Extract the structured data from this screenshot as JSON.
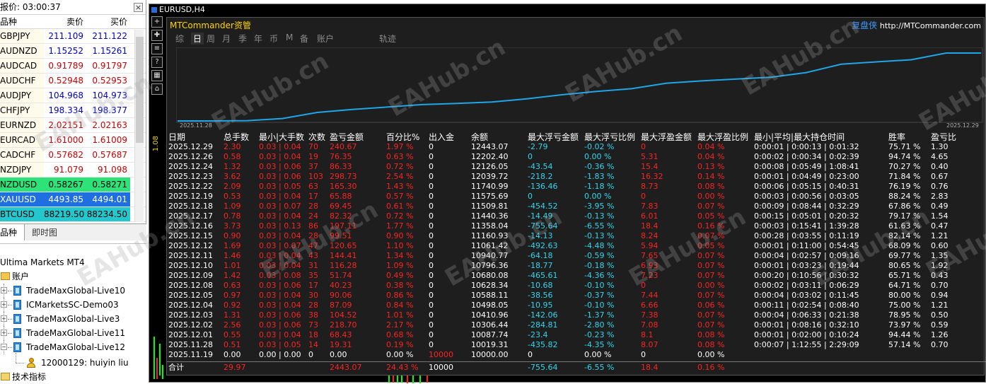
{
  "market_watch": {
    "title": "报价: 03:00:37",
    "close_icon": "close-icon",
    "columns": {
      "symbol": "品种",
      "bid": "卖价",
      "ask": "买价"
    },
    "rows": [
      {
        "symbol": "GBPJPY",
        "bid": "211.109",
        "ask": "211.122",
        "bid_color": "#0000cc",
        "ask_color": "#0000cc",
        "bg": ""
      },
      {
        "symbol": "AUDNZD",
        "bid": "1.15252",
        "ask": "1.15261",
        "bid_color": "#0000cc",
        "ask_color": "#0000cc",
        "bg": ""
      },
      {
        "symbol": "AUDCAD",
        "bid": "0.91789",
        "ask": "0.91797",
        "bid_color": "#cc0000",
        "ask_color": "#cc0000",
        "bg": ""
      },
      {
        "symbol": "AUDCHF",
        "bid": "0.52948",
        "ask": "0.52953",
        "bid_color": "#cc0000",
        "ask_color": "#cc0000",
        "bg": ""
      },
      {
        "symbol": "AUDJPY",
        "bid": "104.968",
        "ask": "104.973",
        "bid_color": "#0000cc",
        "ask_color": "#0000cc",
        "bg": ""
      },
      {
        "symbol": "CHFJPY",
        "bid": "198.334",
        "ask": "198.377",
        "bid_color": "#0000cc",
        "ask_color": "#0000cc",
        "bg": ""
      },
      {
        "symbol": "EURNZD",
        "bid": "2.02151",
        "ask": "2.02163",
        "bid_color": "#cc0000",
        "ask_color": "#cc0000",
        "bg": ""
      },
      {
        "symbol": "EURCAD",
        "bid": "1.61000",
        "ask": "1.61009",
        "bid_color": "#cc0000",
        "ask_color": "#cc0000",
        "bg": ""
      },
      {
        "symbol": "CADCHF",
        "bid": "0.57682",
        "ask": "0.57687",
        "bid_color": "#cc0000",
        "ask_color": "#cc0000",
        "bg": ""
      },
      {
        "symbol": "NZDJPY",
        "bid": "91.079",
        "ask": "91.098",
        "bid_color": "#cc0000",
        "ask_color": "#cc0000",
        "bg": ""
      },
      {
        "symbol": "NZDUSD",
        "bid": "0.58267",
        "ask": "0.58271",
        "bid_color": "#000000",
        "ask_color": "#000000",
        "bg": "#2ee27a"
      },
      {
        "symbol": "XAUUSD",
        "bid": "4493.85",
        "ask": "4494.01",
        "bid_color": "#ffffff",
        "ask_color": "#ffffff",
        "bg": "#1f6fe0"
      },
      {
        "symbol": "BTCUSD",
        "bid": "88219.50",
        "ask": "88234.50",
        "bid_color": "#000000",
        "ask_color": "#000000",
        "bg": "#23c8cf"
      }
    ],
    "tabs": {
      "symbols": "品种",
      "tick_chart": "即时图"
    }
  },
  "navigator": {
    "platform": "Ultima Markets MT4",
    "accounts_label": "账户",
    "accounts": [
      "TradeMaxGlobal-Live10",
      "ICMarketsSC-Demo03",
      "TradeMaxGlobal-Live3",
      "TradeMaxGlobal-Live11",
      "TradeMaxGlobal-Live12"
    ],
    "user": "12000129: huiyin liu",
    "indicators_label": "技术指标"
  },
  "chart": {
    "caption": "EURUSD,H4",
    "price_label": "1.08",
    "tools": [
      "+",
      "✚",
      "≡",
      "?",
      "▦",
      "⌂"
    ]
  },
  "mtc": {
    "title": "MTCommander资管",
    "brand_cn": "复盘侠",
    "brand_url": "http://MTCommander.com",
    "tabs": [
      "综",
      "日",
      "周",
      "月",
      "季",
      "年",
      "币",
      "M",
      "备",
      "账户",
      "轨迹"
    ],
    "active_tab": "日",
    "equity_start_date": "2025.11.28",
    "equity_end_date": "2025.12.29",
    "equity_curve": [
      10000,
      10000,
      10010,
      10087,
      10306,
      10411,
      10498,
      10588,
      10628,
      10680,
      10796,
      10941,
      11061,
      11161,
      11358,
      11440,
      11510,
      11576,
      11741,
      12040,
      12126,
      12202,
      12443,
      12443
    ],
    "columns": [
      "日期",
      "总手数",
      "最小|大手数",
      "次数",
      "盈亏金额",
      "百分比%",
      "出入金",
      "余额",
      "最大浮亏金额",
      "最大浮亏比例",
      "最大浮盈金额",
      "最大浮盈比例",
      "最小|平均|最大持仓时间",
      "胜率",
      "盈亏比"
    ],
    "rows": [
      [
        "2025.12.29",
        "2.30",
        "0.03 | 0.04",
        "70",
        "240.67",
        "1.97 %",
        "0",
        "12443.07",
        "-2.79",
        "-0.02 %",
        "0",
        "0.04 %",
        "0:00:01 | 0:00:13 | 0:01:32",
        "75.71 %",
        "1.30"
      ],
      [
        "2025.12.26",
        "0.58",
        "0.03 | 0.04",
        "19",
        "76.35",
        "0.63 %",
        "0",
        "12202.40",
        "0",
        "0.00 %",
        "5.31",
        "0.04 %",
        "0:00:02 | 0:00:34 | 0:02:39",
        "94.74 %",
        "4.65"
      ],
      [
        "2025.12.24",
        "1.32",
        "0.03 | 0.06",
        "37",
        "86.33",
        "0.72 %",
        "0",
        "12126.05",
        "-43.54",
        "-0.36 %",
        "15.4",
        "0.13 %",
        "0:00:08 | 0:05:49 | 1:08:41",
        "70.27 %",
        "0.40"
      ],
      [
        "2025.12.23",
        "3.62",
        "0.03 | 0.06",
        "103",
        "298.73",
        "2.54 %",
        "0",
        "12039.72",
        "-218.2",
        "-1.83 %",
        "16.32",
        "0.14 %",
        "0:00:01 | 0:04:49 | 0:23:00",
        "71.84 %",
        "0.67"
      ],
      [
        "2025.12.22",
        "2.09",
        "0.03 | 0.05",
        "63",
        "165.30",
        "1.43 %",
        "0",
        "11740.99",
        "-136.46",
        "-1.18 %",
        "8.73",
        "0.08 %",
        "0:00:06 | 0:05:15 | 0:40:31",
        "76.19 %",
        "0.76"
      ],
      [
        "2025.12.19",
        "0.53",
        "0.03 | 0.04",
        "17",
        "65.88",
        "0.57 %",
        "0",
        "11575.69",
        "0",
        "0.00 %",
        "0",
        "0.00 %",
        "0:00:03 | 0:00:56 | 0:03:05",
        "88.24 %",
        "2.83"
      ],
      [
        "2025.12.18",
        "1.09",
        "0.03 | 0.07",
        "28",
        "69.45",
        "0.61 %",
        "0",
        "11509.81",
        "-454.52",
        "-3.95 %",
        "7.83",
        "0.07 %",
        "0:00:09 | 0:08:44 | 0:32:29",
        "67.86 %",
        "0.49"
      ],
      [
        "2025.12.17",
        "0.78",
        "0.03 | 0.04",
        "24",
        "82.32",
        "0.72 %",
        "0",
        "11440.36",
        "-14.49",
        "-0.13 %",
        "6.01",
        "0.05 %",
        "0:00:15 | 0:05:01 | 0:20:32",
        "79.17 %",
        "1.54"
      ],
      [
        "2025.12.16",
        "3.73",
        "0.03 | 0.13",
        "86",
        "197.11",
        "1.77 %",
        "0",
        "11358.04",
        "-755.64",
        "-6.55 %",
        "18.4",
        "0.16 %",
        "0:00:03 | 0:15:41 | 1:39:28",
        "61.63 %",
        "0.47"
      ],
      [
        "2025.12.15",
        "0.90",
        "0.03 | 0.04",
        "28",
        "99.51",
        "0.90 %",
        "0",
        "11160.93",
        "-14.13",
        "-0.13 %",
        "8.24",
        "0.07 %",
        "0:00:28 | 0:03:55 | 0:11:19",
        "82.14 %",
        "1.21"
      ],
      [
        "2025.12.12",
        "1.69",
        "0.03 | 0.07",
        "47",
        "120.65",
        "1.10 %",
        "0",
        "11061.42",
        "-492.63",
        "-4.48 %",
        "5.94",
        "0.05 %",
        "0:00:01 | 0:11:00 | 0:54:45",
        "68.09 %",
        "0.60"
      ],
      [
        "2025.12.11",
        "1.46",
        "0.03 | 0.04",
        "43",
        "144.41",
        "1.34 %",
        "0",
        "10940.77",
        "-64.18",
        "-0.59 %",
        "7.65",
        "0.07 %",
        "0:00:04 | 0:02:57 | 0:09:16",
        "69.77 %",
        "1.35"
      ],
      [
        "2025.12.10",
        "1.01",
        "0.03 | 0.04",
        "31",
        "116.28",
        "1.09 %",
        "0",
        "10796.36",
        "-18.77",
        "-0.18 %",
        "6.93",
        "0.07 %",
        "0:00:01 | 0:03:23 | 0:19:44",
        "80.65 %",
        "1.92"
      ],
      [
        "2025.12.09",
        "1.42",
        "0.03 | 0.08",
        "35",
        "51.74",
        "0.49 %",
        "0",
        "10680.08",
        "-465.61",
        "-4.36 %",
        "7.23",
        "0.07 %",
        "0:00:20 | 0:10:56 | 0:30:32",
        "65.71 %",
        "0.43"
      ],
      [
        "2025.12.08",
        "0.63",
        "0.03 | 0.06",
        "17",
        "40.23",
        "0.38 %",
        "0",
        "10628.34",
        "-10.68",
        "-0.10 %",
        "0",
        "0.00 %",
        "0:00:02 | 0:03:11 | 0:06:29",
        "64.71 %",
        "0.70"
      ],
      [
        "2025.12.05",
        "0.97",
        "0.03 | 0.04",
        "30",
        "90.06",
        "0.86 %",
        "0",
        "10588.11",
        "-38.56",
        "-0.37 %",
        "7.44",
        "0.07 %",
        "0:00:04 | 0:03:02 | 0:11:45",
        "80.00 %",
        "0.94"
      ],
      [
        "2025.12.04",
        "0.92",
        "0.03 | 0.04",
        "28",
        "87.09",
        "0.84 %",
        "0",
        "10498.05",
        "-10.95",
        "-0.10 %",
        "6.66",
        "0.06 %",
        "0:00:11 | 0:02:54 | 0:08:40",
        "75.00 %",
        "1.21"
      ],
      [
        "2025.12.03",
        "1.31",
        "0.03 | 0.06",
        "38",
        "104.52",
        "1.01 %",
        "0",
        "10410.96",
        "-142.06",
        "-1.37 %",
        "7.38",
        "0.07 %",
        "0:00:04 | 0:06:33 | 0:21:38",
        "78.95 %",
        "0.50"
      ],
      [
        "2025.12.02",
        "2.56",
        "0.03 | 0.06",
        "73",
        "218.70",
        "2.17 %",
        "0",
        "10306.44",
        "-284.81",
        "-2.80 %",
        "7.08",
        "0.07 %",
        "0:00:01 | 0:08:16 | 0:32:10",
        "73.97 %",
        "0.59"
      ],
      [
        "2025.12.01",
        "0.55",
        "0.03 | 0.04",
        "18",
        "68.43",
        "0.68 %",
        "0",
        "10087.74",
        "-23.4",
        "-0.23 %",
        "8.1",
        "0.08 %",
        "0:00:01 | 0:02:00 | 0:10:24",
        "94.44 %",
        "1.26"
      ],
      [
        "2025.11.28",
        "0.51",
        "0.03 | 0.05",
        "14",
        "19.31",
        "0.19 %",
        "0",
        "10019.31",
        "-435.82",
        "-4.35 %",
        "8.07",
        "0.08 %",
        "0:00:07 | 1:12:55 | 2:29:09",
        "57.14 %",
        "0.70"
      ],
      [
        "2025.11.19",
        "0.00",
        "0.00 | 0.00",
        "0",
        "0.00",
        "0.00 %",
        "10000",
        "10000.00",
        "0",
        "0.00 %",
        "0",
        "0.00 %",
        "",
        "",
        ""
      ]
    ],
    "total": [
      "合计",
      "29.97",
      "",
      "",
      "2443.07",
      "24.43 %",
      "10000",
      "",
      "-755.64",
      "-6.55 %",
      "18.4",
      "0.16 %",
      "",
      "",
      ""
    ],
    "colors": {
      "white": "#ffffff",
      "red": "#ff2222",
      "cyan": "#2fd6ee",
      "gold": "#ffd300",
      "curve": "#1fa6e8"
    }
  },
  "watermark": "EAHub.cn"
}
